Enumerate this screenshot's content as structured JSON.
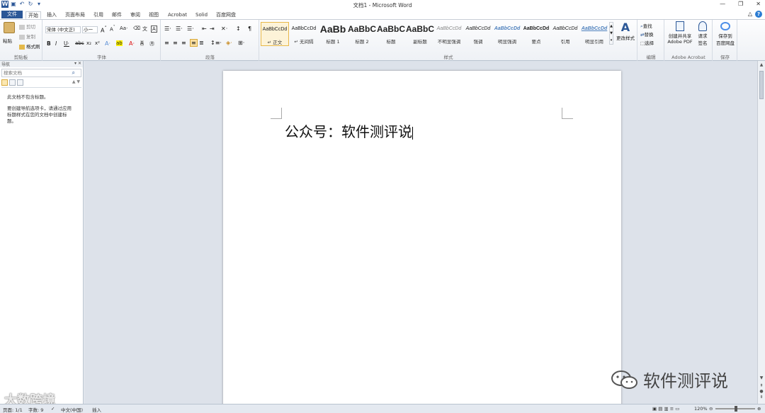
{
  "window": {
    "title": "文档1 - Microsoft Word"
  },
  "tabs": [
    "开始",
    "插入",
    "页面布局",
    "引用",
    "邮件",
    "审阅",
    "视图",
    "Acrobat",
    "Solid",
    "百度网盘"
  ],
  "file_tab": "文件",
  "ribbon": {
    "clipboard": {
      "label": "剪贴板",
      "paste": "粘贴",
      "cut": "剪切",
      "copy": "复制",
      "format_painter": "格式刷"
    },
    "font": {
      "label": "字体",
      "font_name": "宋体 (中文正)",
      "font_size": "小一"
    },
    "paragraph": {
      "label": "段落"
    },
    "styles": {
      "label": "样式",
      "items": [
        {
          "sample": "AaBbCcDd",
          "name": "↵ 正文"
        },
        {
          "sample": "AaBbCcDd",
          "name": "↵ 无间隔"
        },
        {
          "sample": "AaBb",
          "name": "标题 1"
        },
        {
          "sample": "AaBbC",
          "name": "标题 2"
        },
        {
          "sample": "AaBbC",
          "name": "标题"
        },
        {
          "sample": "AaBbC",
          "name": "副标题"
        },
        {
          "sample": "AaBbCcDd",
          "name": "不明显强调"
        },
        {
          "sample": "AaBbCcDd",
          "name": "强调"
        },
        {
          "sample": "AaBbCcDd",
          "name": "明显强调"
        },
        {
          "sample": "AaBbCcDd",
          "name": "要点"
        },
        {
          "sample": "AaBbCcDd",
          "name": "引用"
        },
        {
          "sample": "AaBbCcDd",
          "name": "明显引用"
        }
      ],
      "change_styles": "更改样式"
    },
    "editing": {
      "label": "编辑",
      "find": "查找",
      "replace": "替换",
      "select": "选择"
    },
    "acrobat": {
      "label": "Adobe Acrobat",
      "create_pdf_line1": "创建并共享",
      "create_pdf_line2": "Adobe PDF",
      "request_sign_line1": "请求",
      "request_sign_line2": "签名"
    },
    "save": {
      "label": "保存",
      "save_baidu_line1": "保存到",
      "save_baidu_line2": "百度网盘"
    }
  },
  "nav_pane": {
    "title": "导航",
    "search_placeholder": "搜索文档",
    "message1": "此文档不包含标题。",
    "message2": "要创建导航选项卡，请通过应用标题样式在您的文档中创建标题。"
  },
  "document": {
    "text": "公众号：软件测评说"
  },
  "statusbar": {
    "page": "页面: 1/1",
    "words": "字数: 9",
    "language": "中文(中国)",
    "insert_mode": "插入",
    "zoom": "120%"
  },
  "watermarks": {
    "wechat": "软件测评说",
    "bottom": "大数跨境"
  },
  "colors": {
    "accent": "#2b5797",
    "selected_style": "#fdf3d8"
  }
}
